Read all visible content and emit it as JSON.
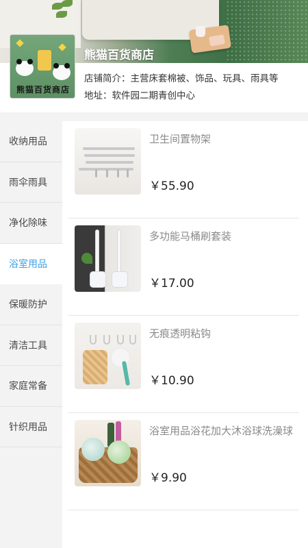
{
  "shop": {
    "name": "熊猫百货商店",
    "logo_text": "熊猫百货商店",
    "intro": "店铺简介：主营床套棉被、饰品、玩具、雨具等",
    "address": "地址：软件园二期青创中心"
  },
  "sidebar": {
    "items": [
      {
        "label": "收纳用品",
        "active": false
      },
      {
        "label": "雨伞雨具",
        "active": false
      },
      {
        "label": "净化除味",
        "active": false
      },
      {
        "label": "浴室用品",
        "active": true
      },
      {
        "label": "保暖防护",
        "active": false
      },
      {
        "label": "清洁工具",
        "active": false
      },
      {
        "label": "家庭常备",
        "active": false
      },
      {
        "label": "针织用品",
        "active": false
      }
    ]
  },
  "products": [
    {
      "name": "卫生间置物架",
      "price": "￥55.90",
      "image": "towel-rack"
    },
    {
      "name": "多功能马桶刷套装",
      "price": "￥17.00",
      "image": "toilet-brush-set"
    },
    {
      "name": "无痕透明粘钩",
      "price": "￥10.90",
      "image": "adhesive-hooks"
    },
    {
      "name": "浴室用品浴花加大沐浴球洗澡球",
      "price": "￥9.90",
      "image": "bath-balls"
    }
  ],
  "colors": {
    "accent": "#3aa0e6",
    "sidebar_bg": "#f3f3f3",
    "price": "#222222"
  }
}
